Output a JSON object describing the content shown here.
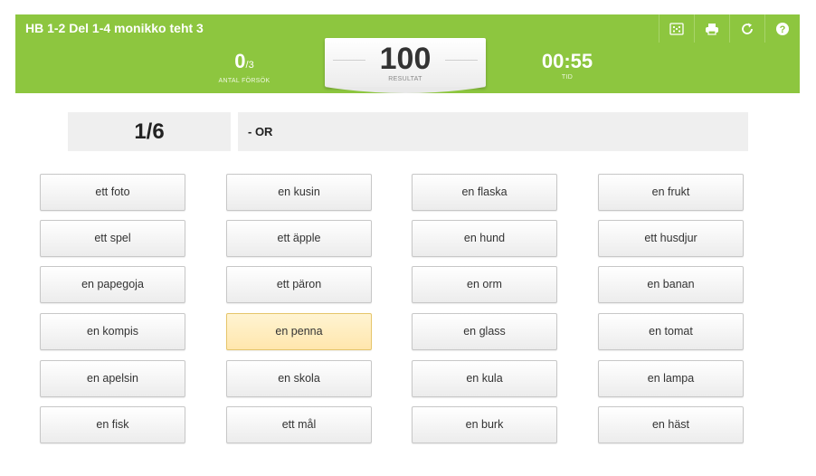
{
  "header": {
    "title": "HB 1-2 Del 1-4 monikko teht 3",
    "tools": [
      "dice-icon",
      "print-icon",
      "restart-icon",
      "help-icon"
    ]
  },
  "stats": {
    "attempts_value": "0",
    "attempts_total": "/3",
    "attempts_label": "ANTAL FÖRSÖK",
    "result_value": "100",
    "result_label": "RESULTAT",
    "time_value": "00:55",
    "time_label": "TID"
  },
  "question": {
    "counter": "1/6",
    "prompt": "- OR"
  },
  "choices": [
    [
      "ett foto",
      "en kusin",
      "en flaska",
      "en frukt"
    ],
    [
      "ett spel",
      "ett äpple",
      "en hund",
      "ett husdjur"
    ],
    [
      "en papegoja",
      "ett päron",
      "en orm",
      "en banan"
    ],
    [
      "en kompis",
      "en penna",
      "en glass",
      "en tomat"
    ],
    [
      "en apelsin",
      "en skola",
      "en kula",
      "en lampa"
    ],
    [
      "en fisk",
      "ett mål",
      "en burk",
      "en häst"
    ]
  ],
  "highlighted_choice": "en penna",
  "colors": {
    "accent": "#8dc63f",
    "highlight": "#ffe6ad"
  }
}
